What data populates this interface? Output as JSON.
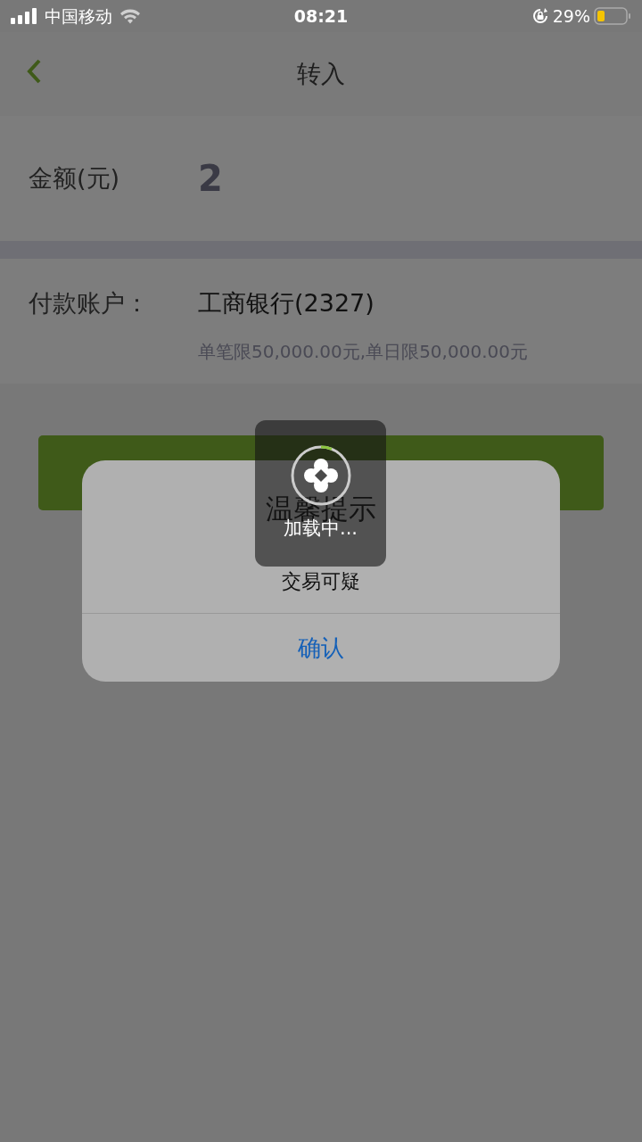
{
  "status_bar": {
    "carrier": "中国移动",
    "time": "08:21",
    "battery_percent": "29%"
  },
  "nav": {
    "title": "转入"
  },
  "form": {
    "amount": {
      "label": "金额(元)",
      "value": "2"
    },
    "account": {
      "label": "付款账户：",
      "value": "工商银行(2327)",
      "limit": "单笔限50,000.00元,单日限50,000.00元"
    }
  },
  "dialog": {
    "title": "温馨提示",
    "message": "交易可疑",
    "button": "确认"
  },
  "loading": {
    "text": "加载中..."
  }
}
